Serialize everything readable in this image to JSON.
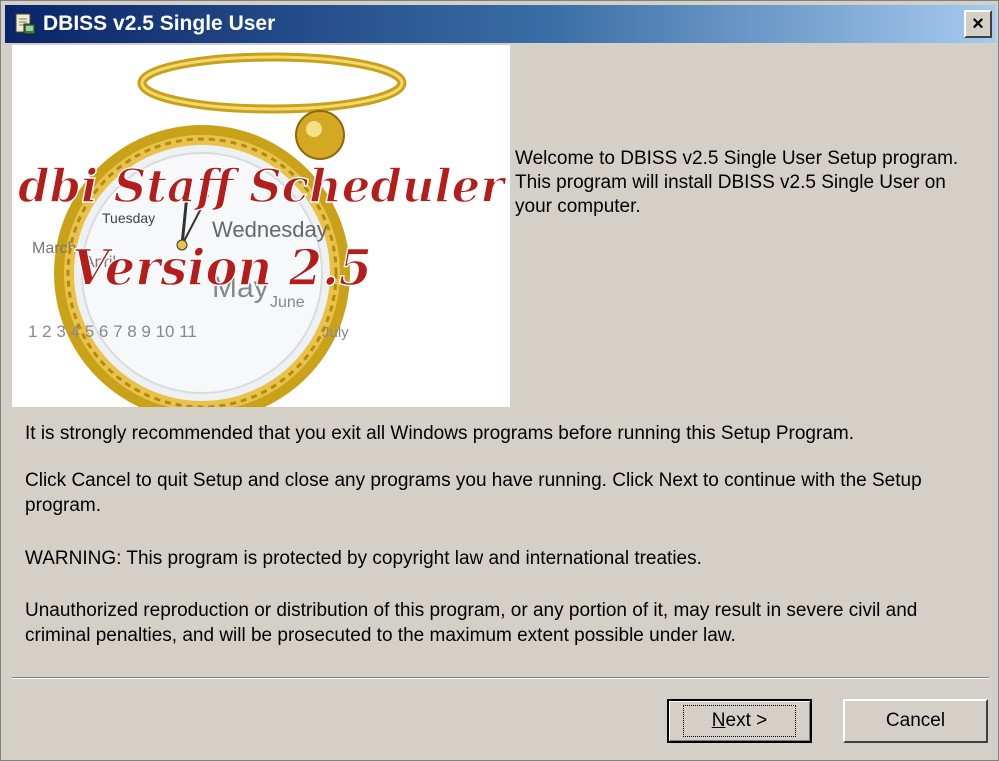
{
  "window": {
    "title": "DBISS v2.5 Single User",
    "icon": "installer-icon",
    "close_label": "×"
  },
  "splash": {
    "headline": "dbi Staff Scheduler",
    "version": "Version 2.5",
    "clock_words": [
      "Tuesday",
      "Wednesday",
      "March",
      "April",
      "May",
      "June",
      "July"
    ],
    "clock_numbers": "1 2 3 4 5 6 7 8 9 10 11"
  },
  "content": {
    "welcome": "Welcome to DBISS v2.5  Single User Setup program. This program will install DBISS v2.5 Single User on your computer.",
    "recommendation": "It is strongly recommended that you exit all Windows programs before running this Setup Program.",
    "instructions": "Click Cancel to quit Setup and close any programs you have running.  Click Next to continue with the Setup program.",
    "warning": "WARNING: This program is protected by copyright law and international treaties.",
    "legal": "Unauthorized reproduction or distribution of this program, or any portion of it, may result in severe civil and criminal penalties, and will be prosecuted to the maximum extent possible under law."
  },
  "buttons": {
    "next_mnemonic": "N",
    "next_rest": "ext >",
    "cancel": "Cancel"
  }
}
